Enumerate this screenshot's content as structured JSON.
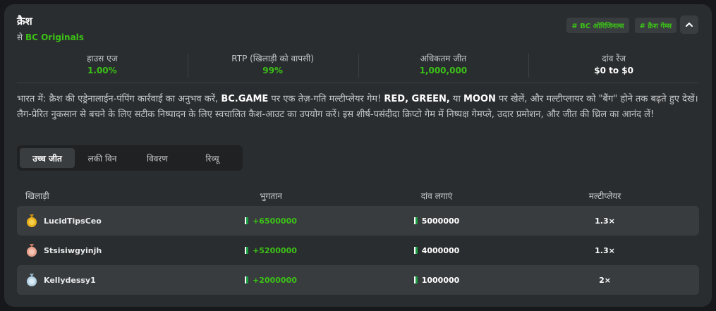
{
  "header": {
    "title": "क्रैश",
    "subtitle_prefix": "से",
    "subtitle_brand": "BC Originals",
    "tags": [
      "# BC ओरिजिनल्स",
      "# क्रैश गेम्स"
    ]
  },
  "stats": [
    {
      "label": "हाउस एज",
      "value": "1.00%"
    },
    {
      "label": "RTP (खिलाड़ी को वापसी)",
      "value": "99%"
    },
    {
      "label": "अधिकतम जीत",
      "value": "1,000,000"
    },
    {
      "label": "दांव रेंज",
      "value": "$0 to $0"
    }
  ],
  "description": {
    "p1": "भारत में: क्रैश की एड्रेनालाईन-पंपिंग कार्रवाई का अनुभव करें, ",
    "b1": "BC.GAME",
    "p2": " पर एक तेज़-गति मल्टीप्लेयर गेम! ",
    "b2": "RED, GREEN,",
    "p3": " या ",
    "b3": "MOON",
    "p4": " पर खेलें, और मल्टीप्लायर को \"बैंग\" होने तक बढ़ते हुए देखें। लैग-प्रेरित नुकसान से बचने के लिए सटीक निष्पादन के लिए स्वचालित कैश-आउट का उपयोग करें। इस शीर्ष-पसंदीदा क्रिप्टो गेम में निष्पक्ष गेमप्ले, उदार प्रमोशन, और जीत की थ्रिल का आनंद लें!"
  },
  "tabs": [
    "उच्च जीत",
    "लकी विन",
    "विवरण",
    "रिव्यू"
  ],
  "table": {
    "headers": [
      "खिलाड़ी",
      "भुगतान",
      "दांव लगाएं",
      "मल्टीप्लेयर"
    ],
    "rows": [
      {
        "player": "LucidTipsCeo",
        "payout": "+6500000",
        "bet": "5000000",
        "multiplier": "1.3×",
        "medal": "gold"
      },
      {
        "player": "Stsisiwgyinjh",
        "payout": "+5200000",
        "bet": "4000000",
        "multiplier": "1.3×",
        "medal": "bronze"
      },
      {
        "player": "Kellydessy1",
        "payout": "+2000000",
        "bet": "1000000",
        "multiplier": "2×",
        "medal": "silver"
      }
    ]
  },
  "colors": {
    "accent": "#3bc117",
    "card": "#2a2d2f",
    "gold": "#e8b21d",
    "bronze": "#e9a590",
    "silver": "#b6d4e6"
  }
}
